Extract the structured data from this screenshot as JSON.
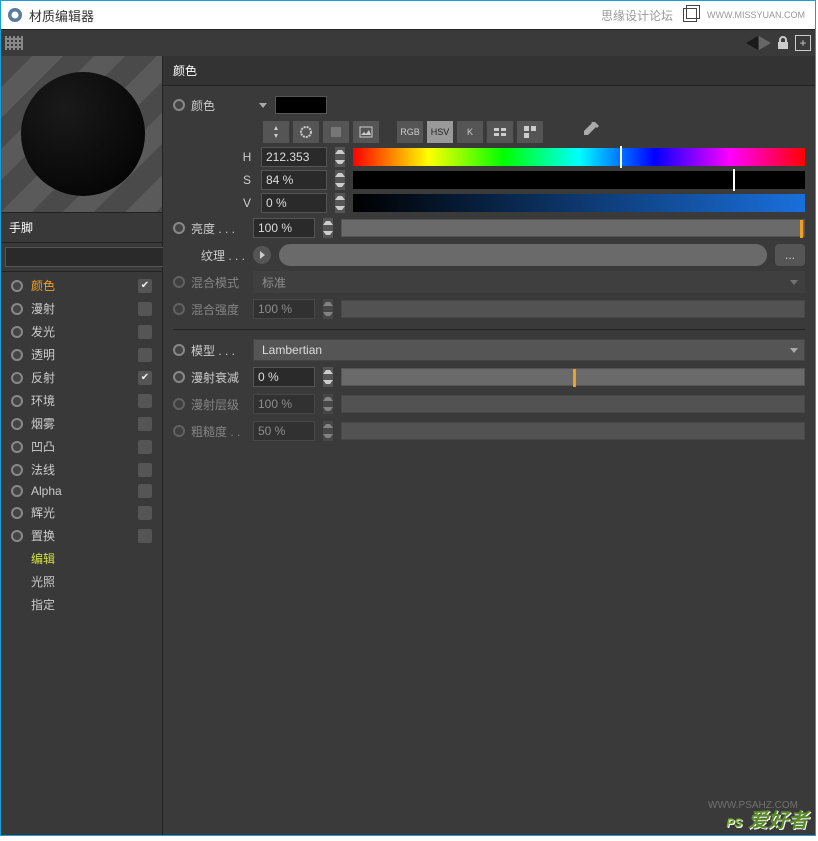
{
  "window": {
    "title": "材质编辑器",
    "forum": "思缘设计论坛",
    "site": "WWW.MISSYUAN.COM"
  },
  "material_name": "手脚",
  "content_header": "颜色",
  "channels": [
    {
      "label": "颜色",
      "checked": true,
      "highlight": true
    },
    {
      "label": "漫射",
      "checked": false
    },
    {
      "label": "发光",
      "checked": false
    },
    {
      "label": "透明",
      "checked": false
    },
    {
      "label": "反射",
      "checked": true
    },
    {
      "label": "环境",
      "checked": false
    },
    {
      "label": "烟雾",
      "checked": false
    },
    {
      "label": "凹凸",
      "checked": false
    },
    {
      "label": "法线",
      "checked": false
    },
    {
      "label": "Alpha",
      "checked": false
    },
    {
      "label": "辉光",
      "checked": false
    },
    {
      "label": "置换",
      "checked": false
    }
  ],
  "extra_items": [
    {
      "label": "编辑",
      "edit": true
    },
    {
      "label": "光照"
    },
    {
      "label": "指定"
    }
  ],
  "color_section": {
    "label": "颜色"
  },
  "icon_labels": {
    "rgb": "RGB",
    "hsv": "HSV",
    "k": "K"
  },
  "hsv": {
    "h_label": "H",
    "h_value": "212.353",
    "s_label": "S",
    "s_value": "84 %",
    "v_label": "V",
    "v_value": "0 %"
  },
  "brightness": {
    "label": "亮度 . . .",
    "value": "100 %"
  },
  "texture": {
    "label": "纹理 . . ."
  },
  "mix_mode": {
    "label": "混合模式",
    "value": "标准"
  },
  "mix_strength": {
    "label": "混合强度",
    "value": "100 %"
  },
  "model": {
    "label": "模型 . . .",
    "value": "Lambertian"
  },
  "diffuse_falloff": {
    "label": "漫射衰减",
    "value": "0 %"
  },
  "diffuse_level": {
    "label": "漫射层级",
    "value": "100 %"
  },
  "roughness": {
    "label": "粗糙度 . .",
    "value": "50 %"
  },
  "watermark": {
    "url": "WWW.PSAHZ.COM",
    "brand": "PS 爱好者"
  }
}
